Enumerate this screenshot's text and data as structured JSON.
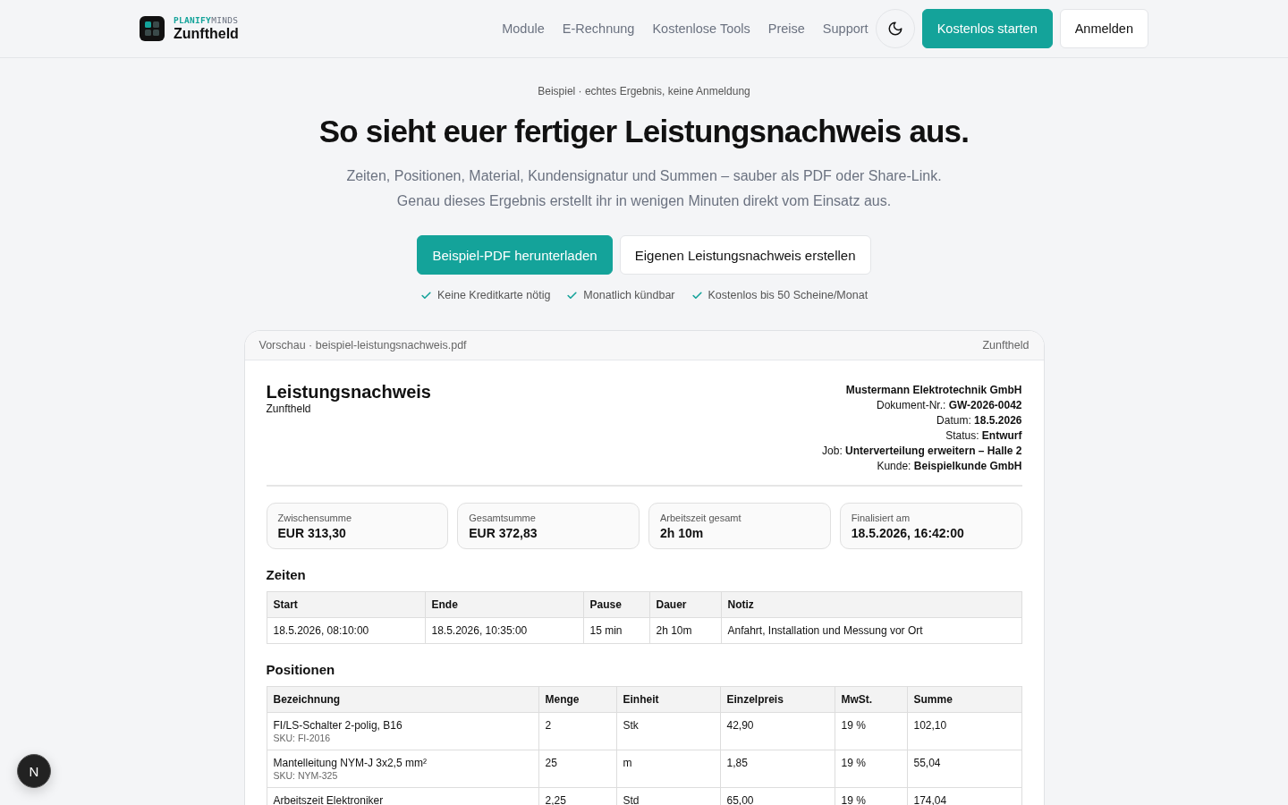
{
  "header": {
    "brand_prefix": "PLANIFY",
    "brand_suffix": "MINDS",
    "brand_name": "Zunftheld",
    "nav": [
      "Module",
      "E-Rechnung",
      "Kostenlose Tools",
      "Preise",
      "Support"
    ],
    "primary_button": "Kostenlos starten",
    "secondary_button": "Anmelden"
  },
  "hero": {
    "eyebrow": "Beispiel · echtes Ergebnis, keine Anmeldung",
    "title": "So sieht euer fertiger Leistungsnachweis aus.",
    "subtitle": "Zeiten, Positionen, Material, Kundensignatur und Summen – sauber als PDF oder Share-Link. Genau dieses Ergebnis erstellt ihr in wenigen Minuten direkt vom Einsatz aus.",
    "buttons": [
      {
        "label": "Beispiel-PDF herunterladen",
        "kind": "primary"
      },
      {
        "label": "Eigenen Leistungsnachweis erstellen",
        "kind": "secondary"
      }
    ],
    "features": [
      "Keine Kreditkarte nötig",
      "Monatlich kündbar",
      "Kostenlos bis 50 Scheine/Monat"
    ]
  },
  "preview": {
    "filename": "Vorschau · beispiel-leistungsnachweis.pdf",
    "brand": "Zunftheld",
    "document": {
      "title": "Leistungsnachweis",
      "subtitle": "Zunftheld",
      "company": "Mustermann Elektrotechnik GmbH",
      "meta": [
        "Dokument-Nr.: **GW-2026-0042**",
        "Datum: **18.5.2026**",
        "Status: **Entwurf**",
        "Job: **Unterverteilung erweitern – Halle 2**",
        "Kunde: **Beispielkunde GmbH**"
      ],
      "summary": [
        {
          "label": "Zwischensumme",
          "value": "EUR 313,30"
        },
        {
          "label": "Gesamtsumme",
          "value": "EUR 372,83"
        },
        {
          "label": "Arbeitszeit gesamt",
          "value": "2h 10m"
        },
        {
          "label": "Finalisiert am",
          "value": "18.5.2026, 16:42:00"
        }
      ],
      "sections": [
        {
          "title": "Zeiten",
          "columns": [
            "Start",
            "Ende",
            "Pause",
            "Dauer",
            "Notiz"
          ],
          "rows": [
            {
              "cells": [
                "18.5.2026, 08:10:00",
                "18.5.2026, 10:35:00",
                "15 min",
                "2h 10m",
                "Anfahrt, Installation und Messung vor Ort"
              ]
            }
          ]
        },
        {
          "title": "Positionen",
          "columns": [
            "Bezeichnung",
            "Menge",
            "Einheit",
            "Einzelpreis",
            "MwSt.",
            "Summe"
          ],
          "rows": [
            {
              "cells": [
                "FI/LS-Schalter 2-polig, B16",
                "2",
                "Stk",
                "42,90",
                "19 %",
                "102,10"
              ],
              "sku": "SKU: FI-2016"
            },
            {
              "cells": [
                "Mantelleitung NYM-J 3x2,5 mm²",
                "25",
                "m",
                "1,85",
                "19 %",
                "55,04"
              ],
              "sku": "SKU: NYM-325"
            },
            {
              "cells": [
                "Arbeitszeit Elektroniker",
                "2,25",
                "Std",
                "65,00",
                "19 %",
                "174,04"
              ]
            }
          ]
        }
      ]
    }
  },
  "dev_badge": "N"
}
